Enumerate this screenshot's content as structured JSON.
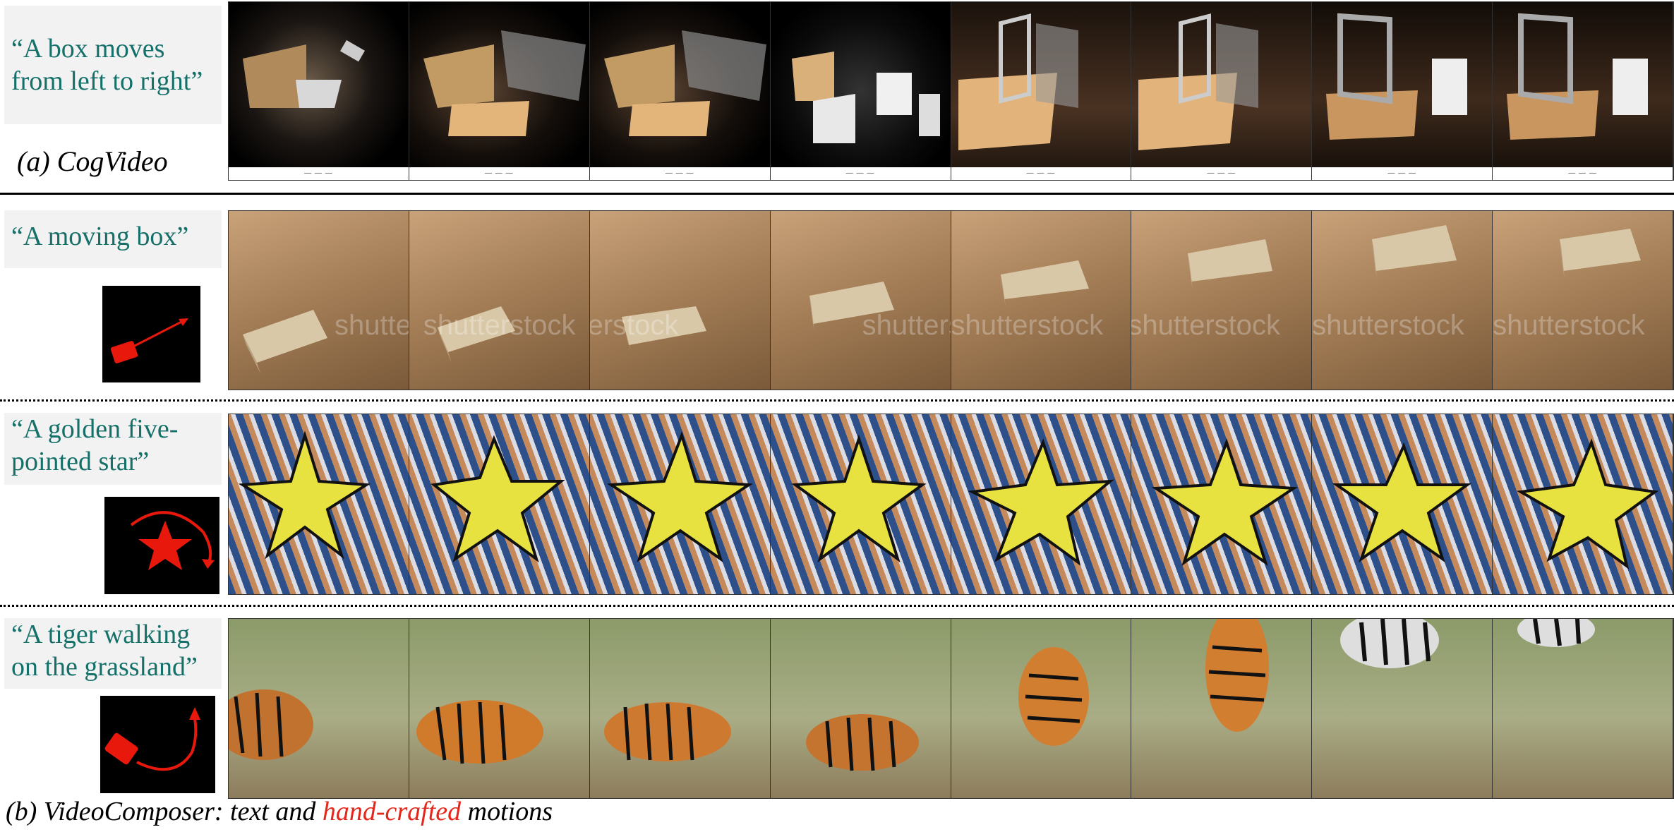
{
  "rows": [
    {
      "prompt_lines": [
        "“A box moves",
        "from left to right”"
      ],
      "label": "(a) CogVideo"
    },
    {
      "prompt_lines": [
        "“A moving box”"
      ],
      "watermark": "shutterstock"
    },
    {
      "prompt_lines": [
        "“A golden five-",
        "pointed star”"
      ]
    },
    {
      "prompt_lines": [
        "“A tiger walking",
        "on the grassland”"
      ]
    }
  ],
  "footer": {
    "part1": "(b) VideoComposer: text and ",
    "highlight": "hand-crafted",
    "part2": " motions"
  },
  "colors": {
    "prompt_text": "#15706a",
    "prompt_bg": "#f2f2f2",
    "highlight": "#e5261a",
    "motion_red": "#e8180c"
  },
  "icons": {
    "row2": "box-with-straight-arrow-icon",
    "row3": "star-with-curved-arrow-icon",
    "row4": "box-with-curved-arrow-icon"
  }
}
